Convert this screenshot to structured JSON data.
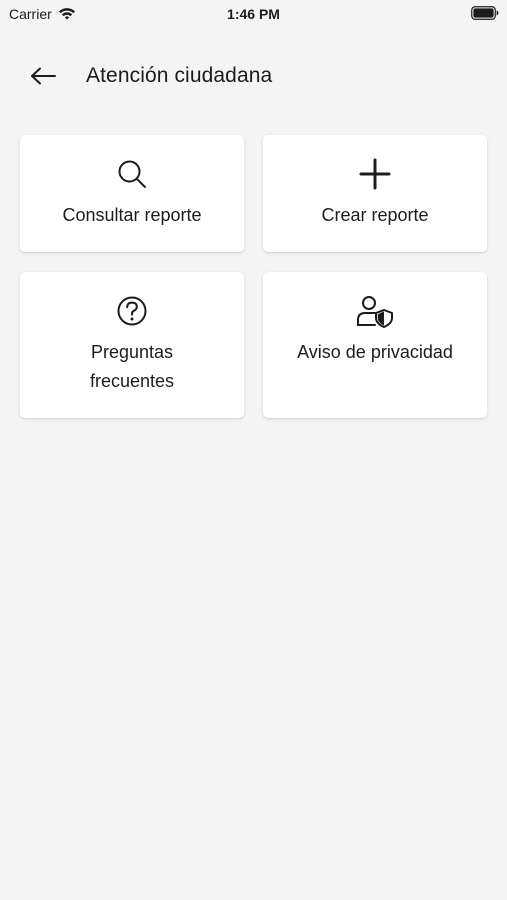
{
  "status_bar": {
    "carrier": "Carrier",
    "time": "1:46 PM",
    "wifi_icon": "wifi-icon",
    "battery_icon": "battery-icon"
  },
  "header": {
    "back_icon": "arrow-left-icon",
    "title": "Atención ciudadana"
  },
  "cards": [
    {
      "label": "Consultar reporte",
      "icon": "search-icon"
    },
    {
      "label": "Crear reporte",
      "icon": "plus-icon"
    },
    {
      "label": "Preguntas frecuentes",
      "icon": "question-circle-icon"
    },
    {
      "label": "Aviso de privacidad",
      "icon": "user-shield-icon"
    }
  ],
  "colors": {
    "background": "#f4f4f4",
    "card": "#ffffff",
    "text": "#1c1c1c"
  }
}
